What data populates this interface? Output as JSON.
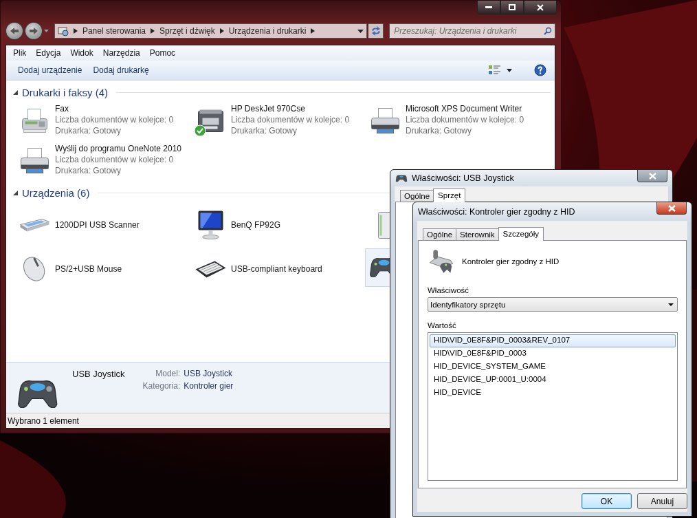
{
  "explorer": {
    "breadcrumb": [
      "Panel sterowania",
      "Sprzęt i dźwięk",
      "Urządzenia i drukarki"
    ],
    "search": {
      "placeholder": "Przeszukaj: Urządzenia i drukarki"
    },
    "menu": [
      "Plik",
      "Edycja",
      "Widok",
      "Narzędzia",
      "Pomoc"
    ],
    "toolbar": [
      "Dodaj urządzenie",
      "Dodaj drukarkę"
    ],
    "groups": [
      {
        "title": "Drukarki i faksy (4)",
        "expanded": true,
        "items": [
          {
            "kind": "fax",
            "name": "Fax",
            "lines": [
              "Liczba dokumentów w kolejce: 0",
              "Drukarka: Gotowy"
            ],
            "default": false,
            "selected": false
          },
          {
            "kind": "mfp",
            "name": "HP DeskJet 970Cse",
            "lines": [
              "Liczba dokumentów w kolejce: 0",
              "Drukarka: Gotowy"
            ],
            "default": true,
            "selected": false
          },
          {
            "kind": "printer",
            "name": "Microsoft XPS Document Writer",
            "lines": [
              "Liczba dokumentów w kolejce: 0",
              "Drukarka: Gotowy"
            ],
            "default": false,
            "selected": false
          },
          {
            "kind": "printer",
            "name": "Wyślij do programu OneNote 2010",
            "lines": [
              "Liczba dokumentów w kolejce: 0",
              "Drukarka: Gotowy"
            ],
            "default": false,
            "selected": false
          }
        ]
      },
      {
        "title": "Urządzenia (6)",
        "expanded": true,
        "items": [
          {
            "kind": "scanner",
            "name": "1200DPI USB Scanner",
            "default": false,
            "selected": false
          },
          {
            "kind": "monitor",
            "name": "BenQ FP92G",
            "default": false,
            "selected": false
          },
          {
            "kind": "drive",
            "default": false,
            "selected": false
          },
          {
            "kind": "mouse",
            "name": "PS/2+USB Mouse",
            "default": false,
            "selected": false
          },
          {
            "kind": "keyboard",
            "name": "USB-compliant keyboard",
            "default": false,
            "selected": false
          },
          {
            "kind": "gamepad",
            "default": false,
            "selected": true
          }
        ]
      }
    ],
    "details": {
      "name": "USB Joystick",
      "fields": [
        {
          "label": "Model:",
          "value": "USB Joystick"
        },
        {
          "label": "Kategoria:",
          "value": "Kontroler gier"
        }
      ]
    },
    "status_bar": "Wybrano 1 element"
  },
  "dialogs": [
    {
      "title": "Właściwości: USB Joystick",
      "active": false,
      "tabs": [
        {
          "label": "Ogólne",
          "selected": false
        },
        {
          "label": "Sprzęt",
          "selected": true
        }
      ]
    },
    {
      "title": "Właściwości: Kontroler gier zgodny z HID",
      "active": true,
      "tabs": [
        {
          "label": "Ogólne",
          "selected": false
        },
        {
          "label": "Sterownik",
          "selected": false
        },
        {
          "label": "Szczegóły",
          "selected": true
        }
      ],
      "device_name": "Kontroler gier zgodny z HID",
      "property_label": "Właściwość",
      "property_value": "Identyfikatory sprzętu",
      "value_label": "Wartość",
      "values": [
        {
          "text": "HID\\VID_0E8F&PID_0003&REV_0107",
          "selected": true
        },
        {
          "text": "HID\\VID_0E8F&PID_0003",
          "selected": false
        },
        {
          "text": "HID_DEVICE_SYSTEM_GAME",
          "selected": false
        },
        {
          "text": "HID_DEVICE_UP:0001_U:0004",
          "selected": false
        },
        {
          "text": "HID_DEVICE",
          "selected": false
        }
      ],
      "buttons": [
        {
          "label": "OK",
          "default": true
        },
        {
          "label": "Anuluj",
          "default": false
        }
      ]
    }
  ]
}
